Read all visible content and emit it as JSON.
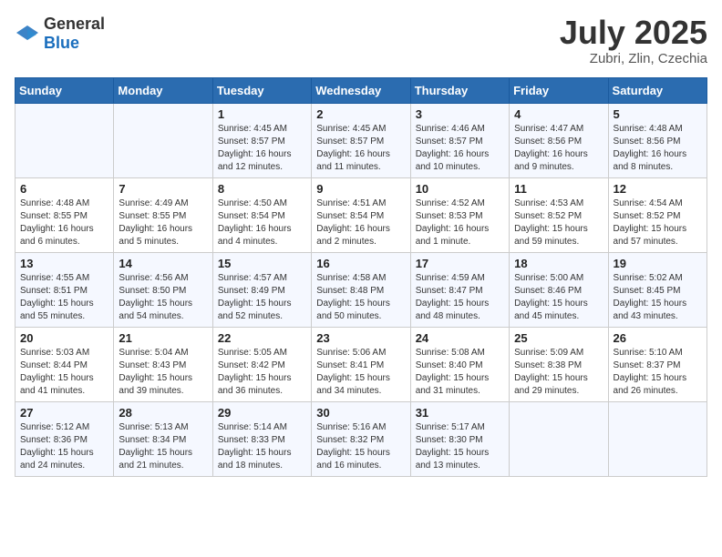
{
  "logo": {
    "general": "General",
    "blue": "Blue"
  },
  "title": "July 2025",
  "location": "Zubri, Zlin, Czechia",
  "weekdays": [
    "Sunday",
    "Monday",
    "Tuesday",
    "Wednesday",
    "Thursday",
    "Friday",
    "Saturday"
  ],
  "weeks": [
    [
      {
        "day": "",
        "info": ""
      },
      {
        "day": "",
        "info": ""
      },
      {
        "day": "1",
        "info": "Sunrise: 4:45 AM\nSunset: 8:57 PM\nDaylight: 16 hours and 12 minutes."
      },
      {
        "day": "2",
        "info": "Sunrise: 4:45 AM\nSunset: 8:57 PM\nDaylight: 16 hours and 11 minutes."
      },
      {
        "day": "3",
        "info": "Sunrise: 4:46 AM\nSunset: 8:57 PM\nDaylight: 16 hours and 10 minutes."
      },
      {
        "day": "4",
        "info": "Sunrise: 4:47 AM\nSunset: 8:56 PM\nDaylight: 16 hours and 9 minutes."
      },
      {
        "day": "5",
        "info": "Sunrise: 4:48 AM\nSunset: 8:56 PM\nDaylight: 16 hours and 8 minutes."
      }
    ],
    [
      {
        "day": "6",
        "info": "Sunrise: 4:48 AM\nSunset: 8:55 PM\nDaylight: 16 hours and 6 minutes."
      },
      {
        "day": "7",
        "info": "Sunrise: 4:49 AM\nSunset: 8:55 PM\nDaylight: 16 hours and 5 minutes."
      },
      {
        "day": "8",
        "info": "Sunrise: 4:50 AM\nSunset: 8:54 PM\nDaylight: 16 hours and 4 minutes."
      },
      {
        "day": "9",
        "info": "Sunrise: 4:51 AM\nSunset: 8:54 PM\nDaylight: 16 hours and 2 minutes."
      },
      {
        "day": "10",
        "info": "Sunrise: 4:52 AM\nSunset: 8:53 PM\nDaylight: 16 hours and 1 minute."
      },
      {
        "day": "11",
        "info": "Sunrise: 4:53 AM\nSunset: 8:52 PM\nDaylight: 15 hours and 59 minutes."
      },
      {
        "day": "12",
        "info": "Sunrise: 4:54 AM\nSunset: 8:52 PM\nDaylight: 15 hours and 57 minutes."
      }
    ],
    [
      {
        "day": "13",
        "info": "Sunrise: 4:55 AM\nSunset: 8:51 PM\nDaylight: 15 hours and 55 minutes."
      },
      {
        "day": "14",
        "info": "Sunrise: 4:56 AM\nSunset: 8:50 PM\nDaylight: 15 hours and 54 minutes."
      },
      {
        "day": "15",
        "info": "Sunrise: 4:57 AM\nSunset: 8:49 PM\nDaylight: 15 hours and 52 minutes."
      },
      {
        "day": "16",
        "info": "Sunrise: 4:58 AM\nSunset: 8:48 PM\nDaylight: 15 hours and 50 minutes."
      },
      {
        "day": "17",
        "info": "Sunrise: 4:59 AM\nSunset: 8:47 PM\nDaylight: 15 hours and 48 minutes."
      },
      {
        "day": "18",
        "info": "Sunrise: 5:00 AM\nSunset: 8:46 PM\nDaylight: 15 hours and 45 minutes."
      },
      {
        "day": "19",
        "info": "Sunrise: 5:02 AM\nSunset: 8:45 PM\nDaylight: 15 hours and 43 minutes."
      }
    ],
    [
      {
        "day": "20",
        "info": "Sunrise: 5:03 AM\nSunset: 8:44 PM\nDaylight: 15 hours and 41 minutes."
      },
      {
        "day": "21",
        "info": "Sunrise: 5:04 AM\nSunset: 8:43 PM\nDaylight: 15 hours and 39 minutes."
      },
      {
        "day": "22",
        "info": "Sunrise: 5:05 AM\nSunset: 8:42 PM\nDaylight: 15 hours and 36 minutes."
      },
      {
        "day": "23",
        "info": "Sunrise: 5:06 AM\nSunset: 8:41 PM\nDaylight: 15 hours and 34 minutes."
      },
      {
        "day": "24",
        "info": "Sunrise: 5:08 AM\nSunset: 8:40 PM\nDaylight: 15 hours and 31 minutes."
      },
      {
        "day": "25",
        "info": "Sunrise: 5:09 AM\nSunset: 8:38 PM\nDaylight: 15 hours and 29 minutes."
      },
      {
        "day": "26",
        "info": "Sunrise: 5:10 AM\nSunset: 8:37 PM\nDaylight: 15 hours and 26 minutes."
      }
    ],
    [
      {
        "day": "27",
        "info": "Sunrise: 5:12 AM\nSunset: 8:36 PM\nDaylight: 15 hours and 24 minutes."
      },
      {
        "day": "28",
        "info": "Sunrise: 5:13 AM\nSunset: 8:34 PM\nDaylight: 15 hours and 21 minutes."
      },
      {
        "day": "29",
        "info": "Sunrise: 5:14 AM\nSunset: 8:33 PM\nDaylight: 15 hours and 18 minutes."
      },
      {
        "day": "30",
        "info": "Sunrise: 5:16 AM\nSunset: 8:32 PM\nDaylight: 15 hours and 16 minutes."
      },
      {
        "day": "31",
        "info": "Sunrise: 5:17 AM\nSunset: 8:30 PM\nDaylight: 15 hours and 13 minutes."
      },
      {
        "day": "",
        "info": ""
      },
      {
        "day": "",
        "info": ""
      }
    ]
  ]
}
